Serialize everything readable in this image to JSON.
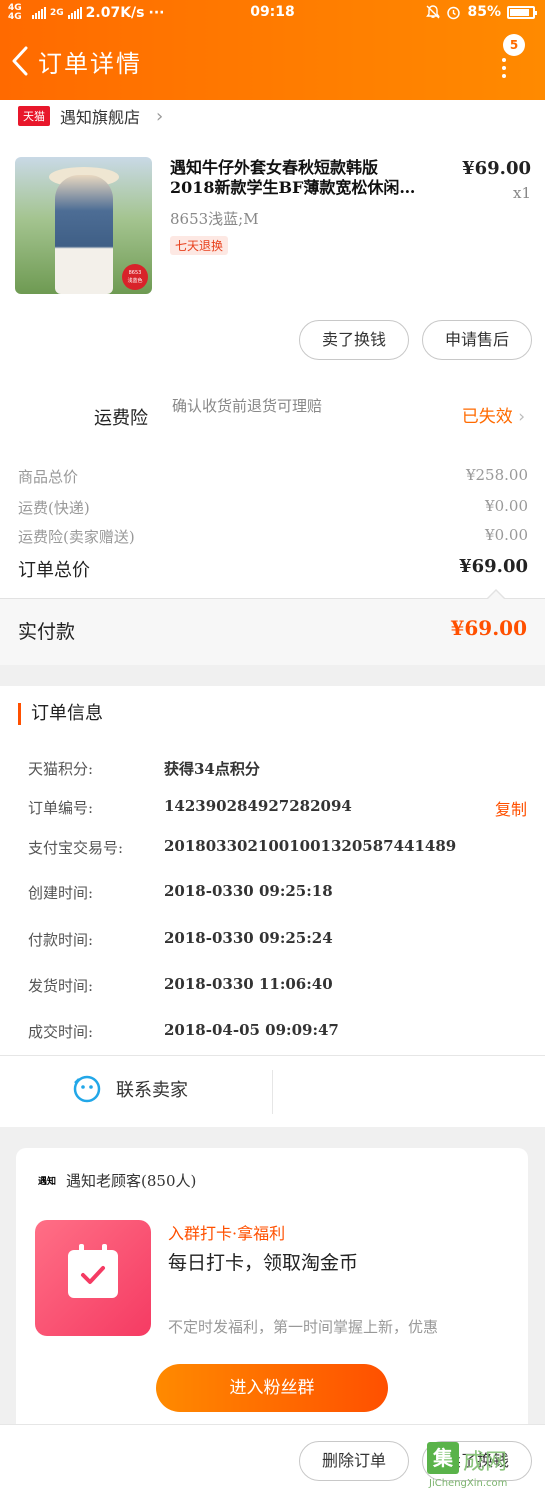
{
  "status_bar": {
    "network": "4G 4G",
    "network2": "2G",
    "speed": "2.07K/s",
    "more": "···",
    "time": "09:18",
    "battery_percent": "85%",
    "battery_level": 0.85
  },
  "header": {
    "title": "订单详情",
    "badge": "5"
  },
  "shop": {
    "badge": "天猫",
    "name": "遇知旗舰店"
  },
  "product": {
    "title_line1": "遇知牛仔外套女春秋短款韩版",
    "title_line2": "2018新款学生BF薄款宽松休闲…",
    "sku": "8653浅蓝;M",
    "return_tag": "七天退换",
    "price": "¥69.00",
    "qty": "x1",
    "image_tag_1": "8653",
    "image_tag_2": "浅蓝色"
  },
  "item_actions": {
    "sell_label": "卖了换钱",
    "after_sales_label": "申请售后"
  },
  "insurance": {
    "label": "运费险",
    "desc": "确认收货前退货可理赔",
    "status": "已失效"
  },
  "fees": [
    {
      "key": "商品总价",
      "value": "¥258.00"
    },
    {
      "key": "运费(快递)",
      "value": "¥0.00"
    },
    {
      "key": "运费险(卖家赠送)",
      "value": "¥0.00"
    }
  ],
  "order_total": {
    "key": "订单总价",
    "value": "¥69.00"
  },
  "paid": {
    "label": "实付款",
    "amount": "¥69.00"
  },
  "order_info": {
    "title": "订单信息",
    "copy_label": "复制",
    "rows": [
      {
        "key": "天猫积分:",
        "value": "获得34点积分"
      },
      {
        "key": "订单编号:",
        "value": "142390284927282094"
      },
      {
        "key": "支付宝交易号:",
        "value": "2018033021001001320587441489"
      },
      {
        "key": "创建时间:",
        "value": "2018-0330 09:25:18"
      },
      {
        "key": "付款时间:",
        "value": "2018-0330 09:25:24"
      },
      {
        "key": "发货时间:",
        "value": "2018-0330 11:06:40"
      },
      {
        "key": "成交时间:",
        "value": "2018-04-05 09:09:47"
      }
    ]
  },
  "contact": {
    "label": "联系卖家"
  },
  "group": {
    "logo": "遇知",
    "name": "遇知老顾客(850人)",
    "tag": "入群打卡·拿福利",
    "title": "每日打卡，领取淘金币",
    "desc": "不定时发福利，第一时间掌握上新，优惠",
    "join_label": "进入粉丝群"
  },
  "bottom_bar": {
    "delete_label": "删除订单",
    "sell_label": "卖了换钱"
  },
  "watermark": {
    "char": "集",
    "text": "成网",
    "url": "JiChengXin.com"
  },
  "colors": {
    "accent": "#ff5000",
    "header": "#ff7a00",
    "tmall": "#e8172b"
  }
}
